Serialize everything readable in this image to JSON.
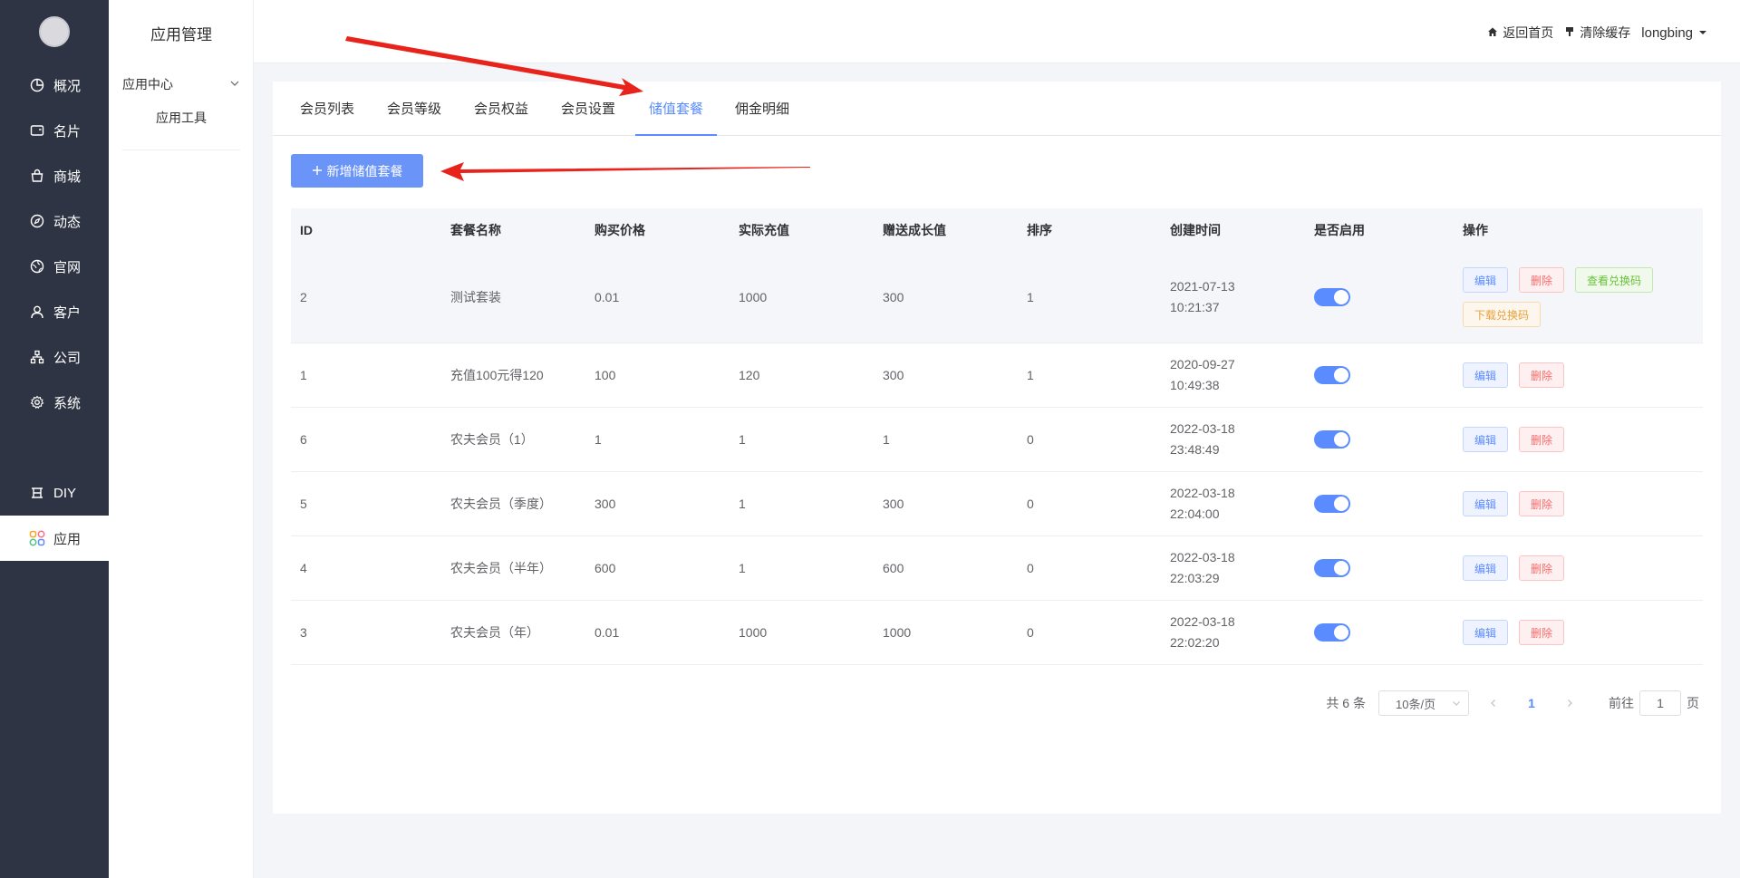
{
  "nav": {
    "logo_text": "",
    "items": [
      {
        "label": "概况",
        "icon": "pie-chart-icon"
      },
      {
        "label": "名片",
        "icon": "card-icon"
      },
      {
        "label": "商城",
        "icon": "shop-bag-icon"
      },
      {
        "label": "动态",
        "icon": "compass-icon"
      },
      {
        "label": "官网",
        "icon": "globe-icon"
      },
      {
        "label": "客户",
        "icon": "user-icon"
      },
      {
        "label": "公司",
        "icon": "org-icon"
      },
      {
        "label": "系统",
        "icon": "gear-icon"
      },
      {
        "label": "DIY",
        "icon": "diy-icon"
      },
      {
        "label": "应用",
        "icon": "apps-icon",
        "active": true
      }
    ]
  },
  "subnav": {
    "title": "应用管理",
    "group": "应用中心",
    "sub_item": "应用工具"
  },
  "header": {
    "home_link": "返回首页",
    "clear_cache": "清除缓存",
    "username": "longbing"
  },
  "tabs": [
    {
      "label": "会员列表"
    },
    {
      "label": "会员等级"
    },
    {
      "label": "会员权益"
    },
    {
      "label": "会员设置"
    },
    {
      "label": "储值套餐",
      "active": true
    },
    {
      "label": "佣金明细"
    }
  ],
  "add_button": "新增储值套餐",
  "table": {
    "columns": [
      "ID",
      "套餐名称",
      "购买价格",
      "实际充值",
      "赠送成长值",
      "排序",
      "创建时间",
      "是否启用",
      "操作"
    ],
    "rows": [
      {
        "id": "2",
        "name": "测试套装",
        "price": "0.01",
        "charge": "1000",
        "growth": "300",
        "sort": "1",
        "date": "2021-07-13",
        "time": "10:21:37",
        "enabled": true,
        "extra": true
      },
      {
        "id": "1",
        "name": "充值100元得120",
        "price": "100",
        "charge": "120",
        "growth": "300",
        "sort": "1",
        "date": "2020-09-27",
        "time": "10:49:38",
        "enabled": true,
        "extra": false
      },
      {
        "id": "6",
        "name": "农夫会员（1）",
        "price": "1",
        "charge": "1",
        "growth": "1",
        "sort": "0",
        "date": "2022-03-18",
        "time": "23:48:49",
        "enabled": true,
        "extra": false
      },
      {
        "id": "5",
        "name": "农夫会员（季度）",
        "price": "300",
        "charge": "1",
        "growth": "300",
        "sort": "0",
        "date": "2022-03-18",
        "time": "22:04:00",
        "enabled": true,
        "extra": false
      },
      {
        "id": "4",
        "name": "农夫会员（半年）",
        "price": "600",
        "charge": "1",
        "growth": "600",
        "sort": "0",
        "date": "2022-03-18",
        "time": "22:03:29",
        "enabled": true,
        "extra": false
      },
      {
        "id": "3",
        "name": "农夫会员（年）",
        "price": "0.01",
        "charge": "1000",
        "growth": "1000",
        "sort": "0",
        "date": "2022-03-18",
        "time": "22:02:20",
        "enabled": true,
        "extra": false
      }
    ],
    "actions": {
      "edit": "编辑",
      "delete": "删除",
      "view_codes": "查看兑换码",
      "download_codes": "下载兑换码"
    }
  },
  "pagination": {
    "total": "共 6 条",
    "page_size": "10条/页",
    "current_page": "1",
    "goto_label": "前往",
    "goto_value": "1",
    "page_suffix": "页"
  },
  "colors": {
    "primary": "#5b8cff",
    "nav_bg": "#2e3443",
    "annotation_arrow": "#e8231b"
  }
}
